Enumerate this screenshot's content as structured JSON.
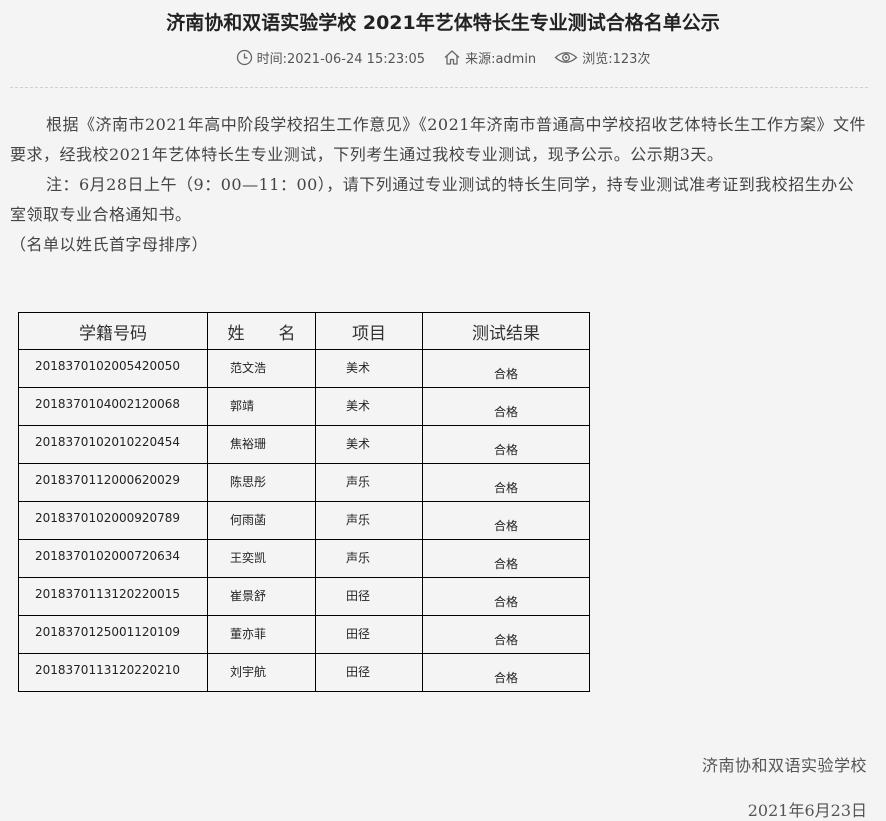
{
  "article": {
    "title": "济南协和双语实验学校 2021年艺体特长生专业测试合格名单公示",
    "meta": {
      "time": "时间:2021-06-24 15:23:05",
      "source": "来源:admin",
      "views": "浏览:123次"
    },
    "paragraph1": "根据《济南市2021年高中阶段学校招生工作意见》《2021年济南市普通高中学校招收艺体特长生工作方案》文件要求，经我校2021年艺体特长生专业测试，下列考生通过我校专业测试，现予公示。公示期3天。",
    "paragraph2": "注：6月28日上午（9：00—11：00），请下列通过专业测试的特长生同学，持专业测试准考证到我校招生办公室领取专业合格通知书。",
    "note": "（名单以姓氏首字母排序）"
  },
  "table": {
    "headers": [
      "学籍号码",
      "姓　　名",
      "项目",
      "测试结果"
    ],
    "rows": [
      {
        "id": "2018370102005420050",
        "name": "范文浩",
        "item": "美术",
        "result": "合格"
      },
      {
        "id": "2018370104002120068",
        "name": "郭靖",
        "item": "美术",
        "result": "合格"
      },
      {
        "id": "2018370102010220454",
        "name": "焦裕珊",
        "item": "美术",
        "result": "合格"
      },
      {
        "id": "2018370112000620029",
        "name": "陈思彤",
        "item": "声乐",
        "result": "合格"
      },
      {
        "id": "2018370102000920789",
        "name": "何雨菡",
        "item": "声乐",
        "result": "合格"
      },
      {
        "id": "2018370102000720634",
        "name": "王奕凯",
        "item": "声乐",
        "result": "合格"
      },
      {
        "id": "2018370113120220015",
        "name": "崔景舒",
        "item": "田径",
        "result": "合格"
      },
      {
        "id": "2018370125001120109",
        "name": "董亦菲",
        "item": "田径",
        "result": "合格"
      },
      {
        "id": "2018370113120220210",
        "name": "刘宇航",
        "item": "田径",
        "result": "合格"
      }
    ]
  },
  "footer": {
    "school": "济南协和双语实验学校",
    "date": "2021年6月23日"
  }
}
